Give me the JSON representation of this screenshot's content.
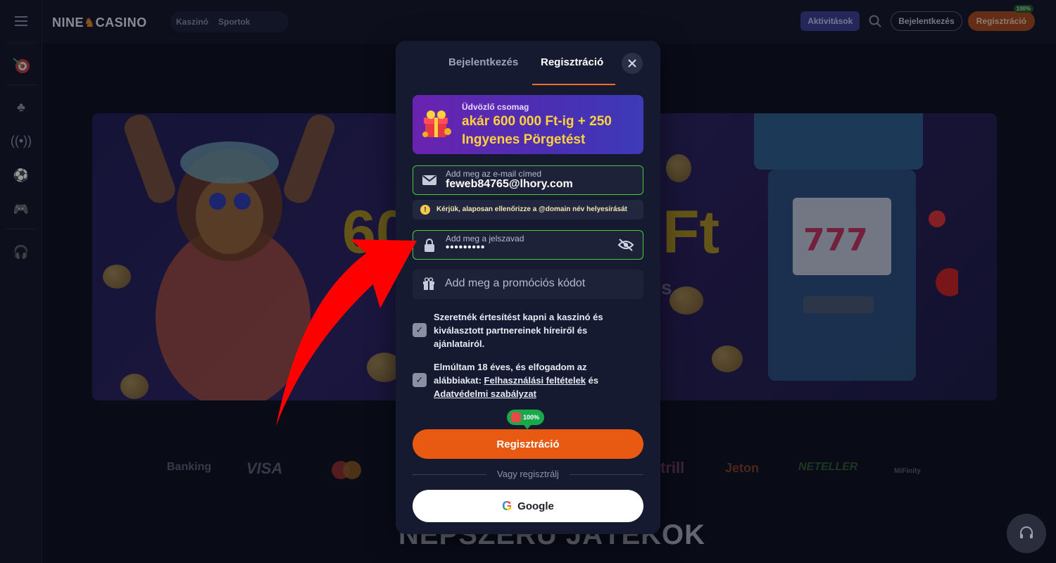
{
  "site": {
    "logo_left": "NINE",
    "logo_right": "CASINO",
    "top_tabs": [
      "Kaszinó",
      "Sportok"
    ],
    "activities_label": "Aktivitások",
    "login_label": "Bejelentkezés",
    "register_label": "Regisztráció",
    "register_badge": "100%"
  },
  "banner": {
    "big_left": "60",
    "big_right": "Ft",
    "small_right": "s"
  },
  "payments": [
    "Banking",
    "VISA",
    "trill",
    "Jeton",
    "NETELLER",
    "MiFinity"
  ],
  "popular_heading": "NÉPSZERŰ JÁTÉKOK",
  "modal": {
    "tabs": {
      "login": "Bejelentkezés",
      "register": "Regisztráció"
    },
    "promo": {
      "subtitle": "Üdvözlő csomag",
      "title": "akár 600 000 Ft-ig + 250 Ingyenes Pörgetést"
    },
    "email": {
      "label": "Add meg az e-mail címed",
      "value": "feweb84765@lhory.com"
    },
    "warning": "Kérjük, alaposan ellenőrizze a @domain név helyesírását",
    "password": {
      "label": "Add meg a jelszavad",
      "value": "•••••••••"
    },
    "promo_code": {
      "placeholder": "Add meg a promóciós kódot"
    },
    "consent_marketing": "Szeretnék értesítést kapni a kaszinó és kiválasztott partnereinek híreiről és ajánlatairól.",
    "consent_terms": {
      "prefix": "Elmúltam 18 éves, és elfogadom az alábbiakat: ",
      "link1": "Felhasználási feltételek",
      "middle": " és ",
      "link2": "Adatvédelmi szabályzat"
    },
    "bonus_badge": "100%",
    "register_button": "Regisztráció",
    "or_text": "Vagy regisztrálj",
    "google_button": "Google"
  },
  "colors": {
    "accent_orange": "#e85a12",
    "valid_green": "#4acb3e",
    "promo_gold": "#ffd23c",
    "arrow_red": "#ff0000"
  }
}
